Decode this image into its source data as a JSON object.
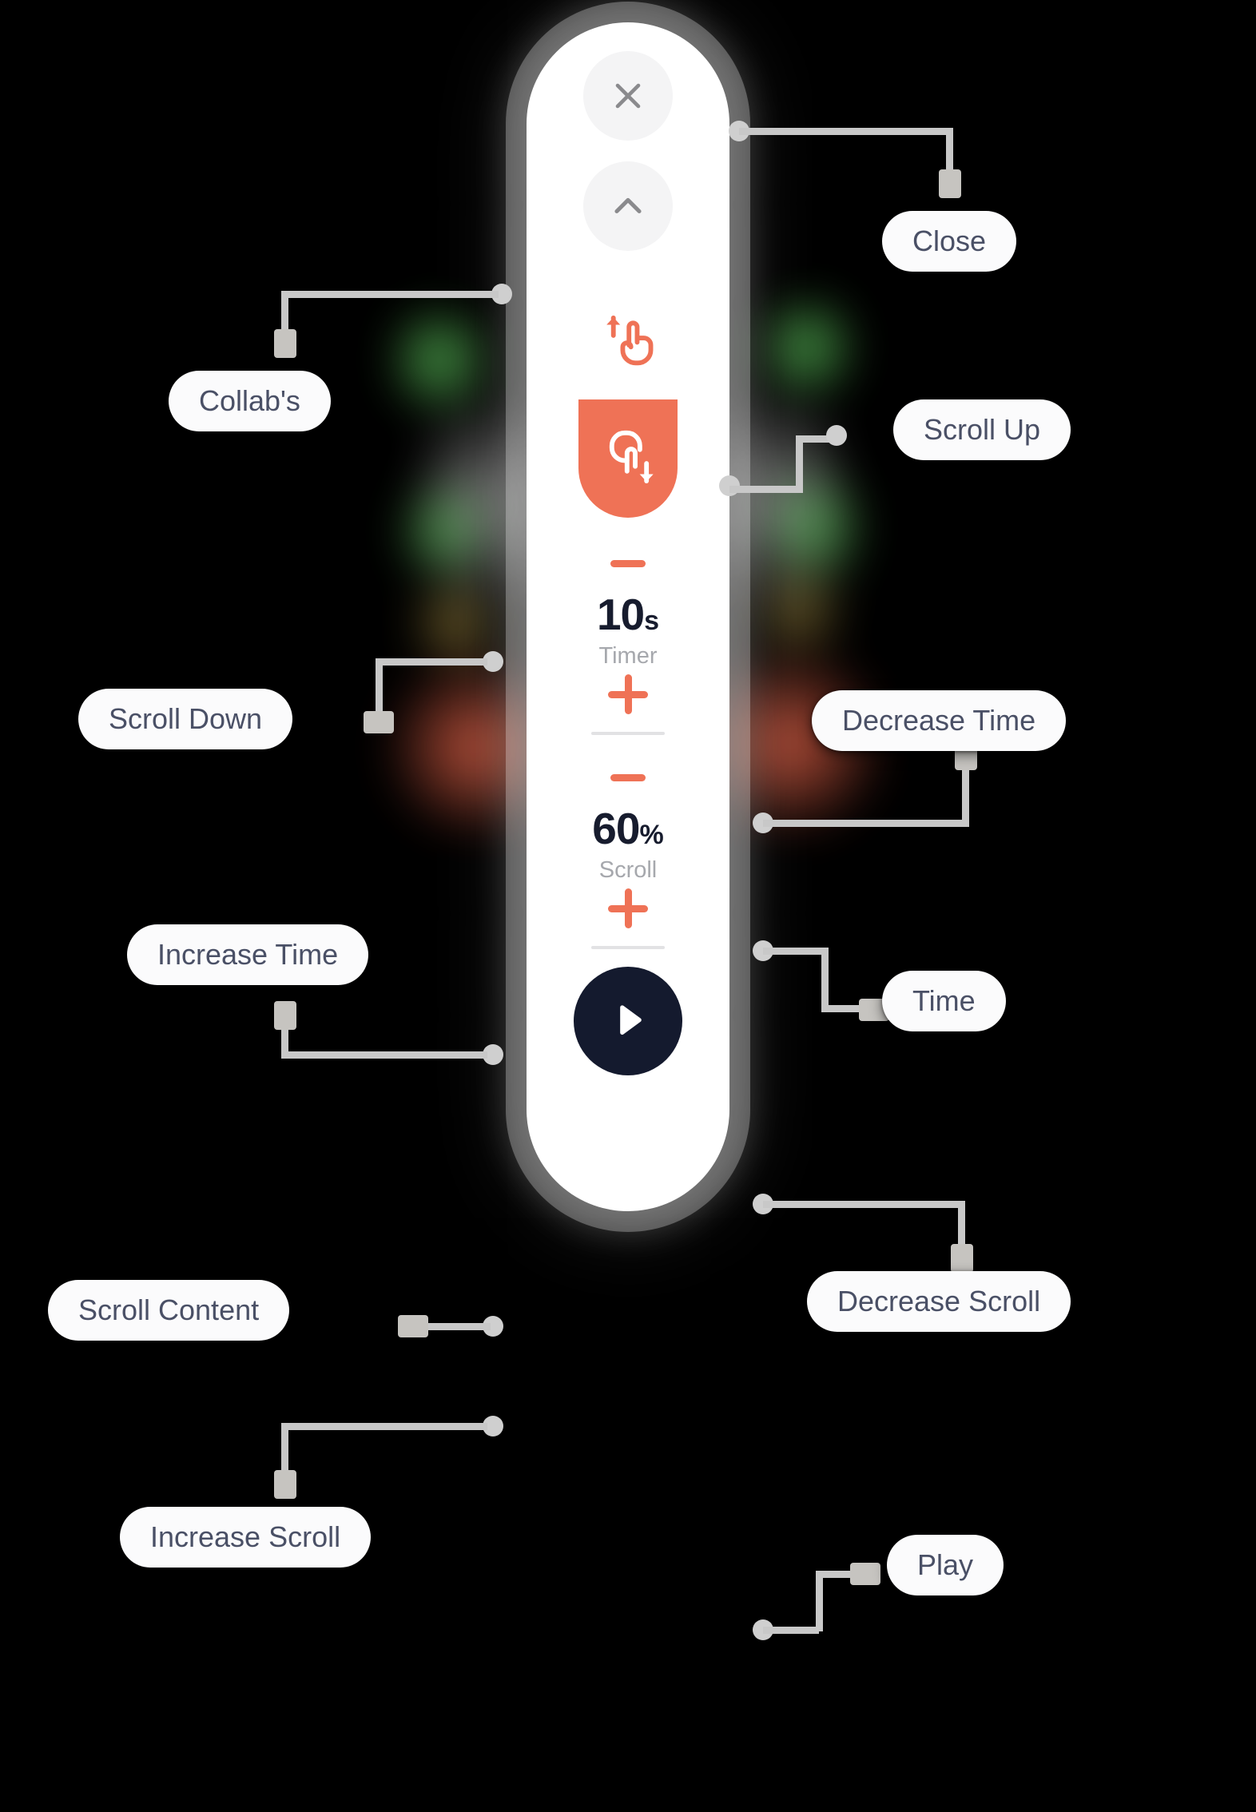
{
  "device": {
    "name": "scroll-controller-widget",
    "accent_color": "#ef7256",
    "dark_color": "#141a2e",
    "label_text_color": "#4a5066",
    "buttons": {
      "close_icon": "close-x-icon",
      "scroll_up_chevron_icon": "chevron-up-icon",
      "scroll_up_gesture_icon": "finger-swipe-up-icon",
      "scroll_down_gesture_icon": "finger-swipe-down-icon",
      "play_icon": "play-triangle-icon",
      "minus_icon": "minus-icon",
      "plus_icon": "plus-icon"
    },
    "timer": {
      "value": "10",
      "unit": "s",
      "caption": "Timer"
    },
    "scroll": {
      "value": "60",
      "unit": "%",
      "caption": "Scroll"
    }
  },
  "callouts": {
    "close": "Close",
    "scroll_up": "Scroll Up",
    "collabs": "Collab's",
    "scroll_down": "Scroll Down",
    "decrease_time": "Decrease Time",
    "increase_time": "Increase Time",
    "time": "Time",
    "decrease_scroll": "Decrease Scroll",
    "scroll_content": "Scroll Content",
    "increase_scroll": "Increase Scroll",
    "play": "Play"
  }
}
